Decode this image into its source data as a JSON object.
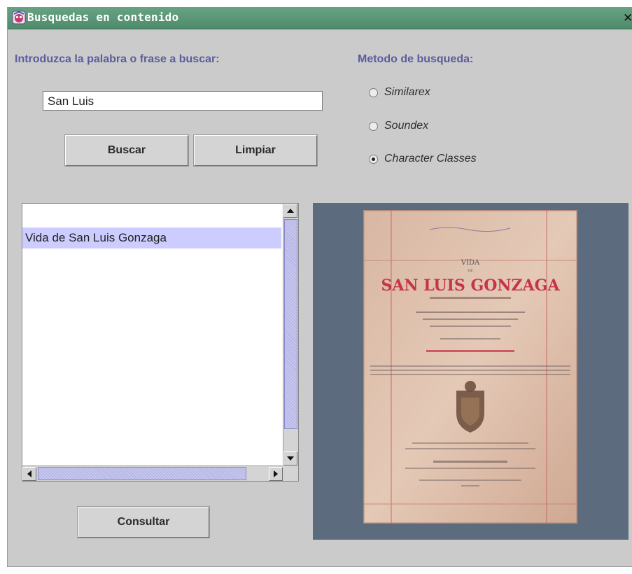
{
  "window": {
    "title": "Busquedas en contenido",
    "close_label": "✕"
  },
  "search": {
    "prompt_label": "Introduzca la palabra o frase a buscar:",
    "value": "San Luis"
  },
  "buttons": {
    "search_label": "Buscar",
    "clear_label": "Limpiar",
    "consult_label": "Consultar"
  },
  "method": {
    "label": "Metodo de busqueda:",
    "options": [
      {
        "label": "Similarex",
        "selected": false
      },
      {
        "label": "Soundex",
        "selected": false
      },
      {
        "label": "Character Classes",
        "selected": true
      }
    ]
  },
  "results": {
    "items": [
      "Vida de San Luis Gonzaga"
    ]
  },
  "preview": {
    "cover_lines": [
      "VIDA",
      "DE",
      "SAN LUIS GONZAGA"
    ]
  },
  "colors": {
    "titlebar": "#5a9878",
    "label": "#5a5ca0",
    "selection": "#ccccff",
    "preview_bg": "#5c6b7e",
    "scroll_thumb": "#b7b7e8"
  }
}
